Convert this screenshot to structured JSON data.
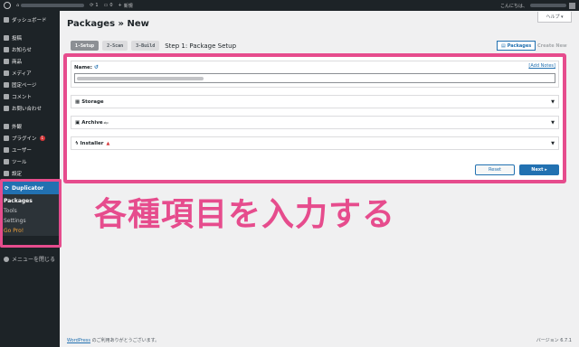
{
  "adminbar": {
    "comments_count": "1",
    "updates_count": "0",
    "new_label": "新規",
    "greeting": "こんにちは、"
  },
  "sidebar": {
    "dashboard": "ダッシュボード",
    "posts": "投稿",
    "news": "お知らせ",
    "products": "商品",
    "media": "メディア",
    "pages": "固定ページ",
    "comments": "コメント",
    "contact": "お問い合わせ",
    "appearance": "外観",
    "plugins": "プラグイン",
    "plugins_badge": "1",
    "users": "ユーザー",
    "tools": "ツール",
    "settings": "設定",
    "duplicator": "Duplicator",
    "dup_packages": "Packages",
    "dup_tools": "Tools",
    "dup_settings": "Settings",
    "dup_pro": "Go Pro!",
    "collapse": "メニューを閉じる"
  },
  "header": {
    "title": "Packages » New",
    "help": "ヘルプ ▾"
  },
  "steps": [
    {
      "label": "1-Setup"
    },
    {
      "label": "2-Scan"
    },
    {
      "label": "3-Build"
    }
  ],
  "step_title": "Step 1: Package Setup",
  "packages_button": "Packages",
  "create_new": "Create New",
  "form": {
    "name_label": "Name:",
    "name_icon": "↺",
    "add_notes": "[Add Notes]",
    "storage": "Storage",
    "archive": "Archive",
    "archive_sup": "zip",
    "installer": "Installer",
    "installer_warn": "▲",
    "reset": "Reset",
    "next": "Next ▸"
  },
  "caption": "各種項目を入力する",
  "footer": {
    "link": "WordPress",
    "text": " のご利用ありがとうございます。",
    "version": "バージョン 6.7.1"
  },
  "colors": {
    "highlight": "#e64c8d",
    "accent": "#2271b1",
    "sidebar_bg": "#1d2327"
  }
}
